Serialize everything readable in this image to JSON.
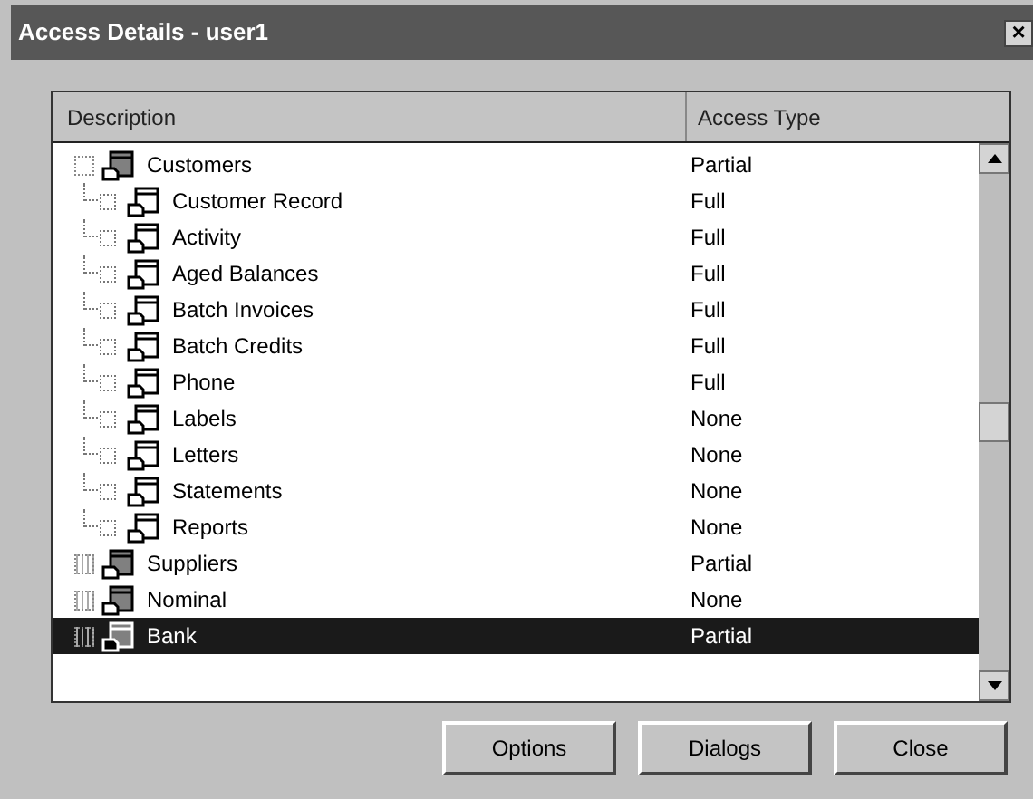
{
  "window": {
    "title": "Access Details - user1",
    "close": "×"
  },
  "table": {
    "columns": [
      "Description",
      "Access Type"
    ],
    "rows": [
      {
        "label": "Customers",
        "access": "Partial",
        "expanded": true,
        "selected": false,
        "children": [
          {
            "label": "Customer Record",
            "access": "Full",
            "selected": false
          },
          {
            "label": "Activity",
            "access": "Full",
            "selected": false
          },
          {
            "label": "Aged Balances",
            "access": "Full",
            "selected": false
          },
          {
            "label": "Batch Invoices",
            "access": "Full",
            "selected": false
          },
          {
            "label": "Batch Credits",
            "access": "Full",
            "selected": false
          },
          {
            "label": "Phone",
            "access": "Full",
            "selected": false
          },
          {
            "label": "Labels",
            "access": "None",
            "selected": false
          },
          {
            "label": "Letters",
            "access": "None",
            "selected": false
          },
          {
            "label": "Statements",
            "access": "None",
            "selected": false
          },
          {
            "label": "Reports",
            "access": "None",
            "selected": false
          }
        ]
      },
      {
        "label": "Suppliers",
        "access": "Partial",
        "expanded": false,
        "selected": false
      },
      {
        "label": "Nominal",
        "access": "None",
        "expanded": false,
        "selected": false
      },
      {
        "label": "Bank",
        "access": "Partial",
        "expanded": false,
        "selected": true
      }
    ]
  },
  "buttons": [
    "Options",
    "Dialogs",
    "Close"
  ]
}
